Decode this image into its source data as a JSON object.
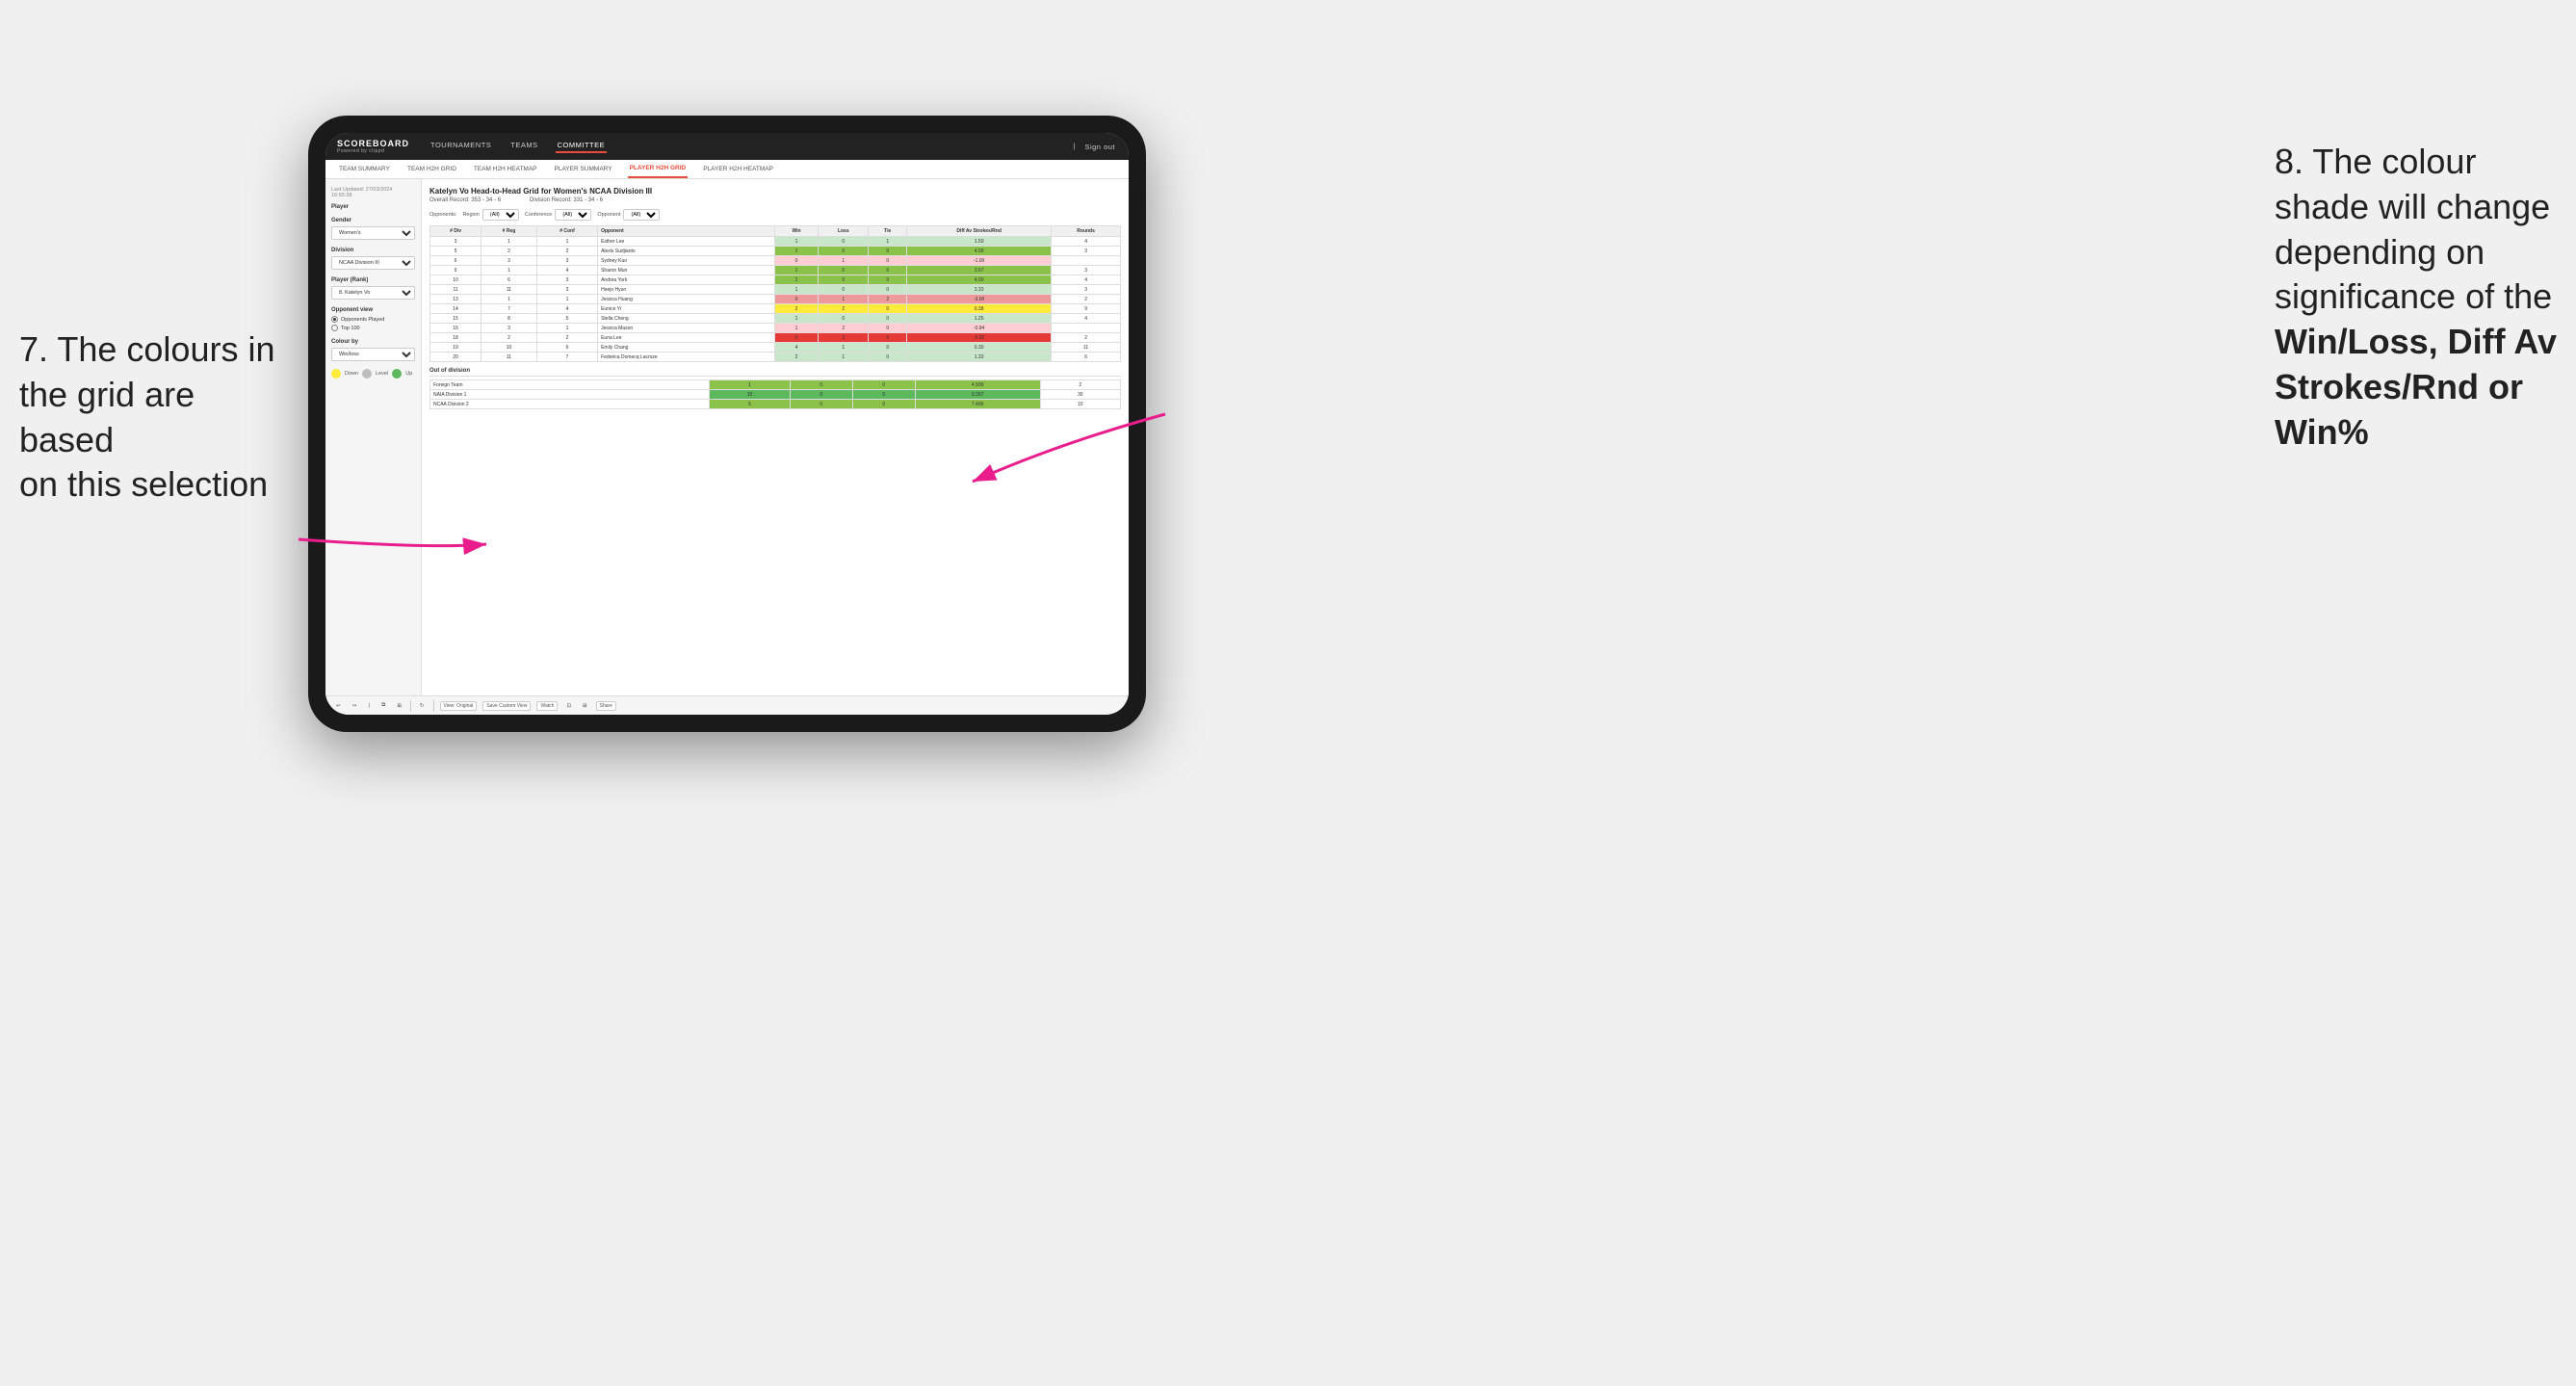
{
  "annotations": {
    "left_text_line1": "7. The colours in",
    "left_text_line2": "the grid are based",
    "left_text_line3": "on this selection",
    "right_text_line1": "8. The colour",
    "right_text_line2": "shade will change",
    "right_text_line3": "depending on",
    "right_text_line4": "significance of the",
    "right_text_bold1": "Win/Loss,",
    "right_text_bold2": "Diff Av",
    "right_text_bold3": "Strokes/Rnd",
    "right_text_bold4": "or",
    "right_text_bold5": "Win%"
  },
  "nav": {
    "logo": "SCOREBOARD",
    "logo_sub": "Powered by clippd",
    "items": [
      "TOURNAMENTS",
      "TEAMS",
      "COMMITTEE"
    ],
    "sign_in": "Sign out"
  },
  "sub_nav": {
    "items": [
      "TEAM SUMMARY",
      "TEAM H2H GRID",
      "TEAM H2H HEATMAP",
      "PLAYER SUMMARY",
      "PLAYER H2H GRID",
      "PLAYER H2H HEATMAP"
    ]
  },
  "sidebar": {
    "meta": "Last Updated: 27/03/2024\n16:55:38",
    "player_label": "Player",
    "gender_label": "Gender",
    "gender_value": "Women's",
    "division_label": "Division",
    "division_value": "NCAA Division III",
    "player_rank_label": "Player (Rank)",
    "player_rank_value": "8. Katelyn Vo",
    "opponent_view_label": "Opponent view",
    "radio1": "Opponents Played",
    "radio2": "Top 100",
    "colour_by_label": "Colour by",
    "colour_by_value": "Win/loss",
    "legend": {
      "down_label": "Down",
      "level_label": "Level",
      "up_label": "Up"
    }
  },
  "grid": {
    "title": "Katelyn Vo Head-to-Head Grid for Women's NCAA Division III",
    "overall_record": "Overall Record: 353 - 34 - 6",
    "division_record": "Division Record: 331 - 34 - 6",
    "opponents_label": "Opponents:",
    "region_label": "Region",
    "conference_label": "Conference",
    "opponent_label": "Opponent",
    "filter_all": "(All)",
    "columns": {
      "div": "# Div",
      "reg": "# Reg",
      "conf": "# Conf",
      "opponent": "Opponent",
      "win": "Win",
      "loss": "Loss",
      "tie": "Tie",
      "diff_av": "Diff Av Strokes/Rnd",
      "rounds": "Rounds"
    },
    "rows": [
      {
        "div": 3,
        "reg": 1,
        "conf": 1,
        "opponent": "Esther Lee",
        "win": 1,
        "loss": 0,
        "tie": 1,
        "diff_av": 1.5,
        "rounds": 4,
        "win_color": "green_light",
        "diff_color": "green_light"
      },
      {
        "div": 5,
        "reg": 2,
        "conf": 2,
        "opponent": "Alexis Sudjianto",
        "win": 1,
        "loss": 0,
        "tie": 0,
        "diff_av": 4.0,
        "rounds": 3,
        "win_color": "green_med",
        "diff_color": "green_med"
      },
      {
        "div": 6,
        "reg": 3,
        "conf": 3,
        "opponent": "Sydney Kuo",
        "win": 0,
        "loss": 1,
        "tie": 0,
        "diff_av": -1.0,
        "rounds": "",
        "win_color": "red_light",
        "diff_color": "red_light"
      },
      {
        "div": 9,
        "reg": 1,
        "conf": 4,
        "opponent": "Sharon Mun",
        "win": 1,
        "loss": 0,
        "tie": 0,
        "diff_av": 3.67,
        "rounds": 3,
        "win_color": "green_med",
        "diff_color": "green_med"
      },
      {
        "div": 10,
        "reg": 6,
        "conf": 3,
        "opponent": "Andrea York",
        "win": 2,
        "loss": 0,
        "tie": 0,
        "diff_av": 4.0,
        "rounds": 4,
        "win_color": "green_med",
        "diff_color": "green_med"
      },
      {
        "div": 11,
        "reg": 11,
        "conf": 3,
        "opponent": "Heejo Hyun",
        "win": 1,
        "loss": 0,
        "tie": 0,
        "diff_av": 3.33,
        "rounds": 3,
        "win_color": "green_light",
        "diff_color": "green_light"
      },
      {
        "div": 13,
        "reg": 1,
        "conf": 1,
        "opponent": "Jessica Huang",
        "win": 0,
        "loss": 1,
        "tie": 2,
        "diff_av": -3.0,
        "rounds": 2,
        "win_color": "red_med",
        "diff_color": "red_med"
      },
      {
        "div": 14,
        "reg": 7,
        "conf": 4,
        "opponent": "Eunice Yi",
        "win": 2,
        "loss": 2,
        "tie": 0,
        "diff_av": 0.38,
        "rounds": 9,
        "win_color": "yellow",
        "diff_color": "yellow"
      },
      {
        "div": 15,
        "reg": 8,
        "conf": 5,
        "opponent": "Stella Cheng",
        "win": 1,
        "loss": 0,
        "tie": 0,
        "diff_av": 1.25,
        "rounds": 4,
        "win_color": "green_light",
        "diff_color": "green_light"
      },
      {
        "div": 16,
        "reg": 3,
        "conf": 1,
        "opponent": "Jessica Mason",
        "win": 1,
        "loss": 2,
        "tie": 0,
        "diff_av": -0.94,
        "rounds": "",
        "win_color": "red_light",
        "diff_color": "red_light"
      },
      {
        "div": 18,
        "reg": 2,
        "conf": 2,
        "opponent": "Euna Lee",
        "win": 0,
        "loss": 2,
        "tie": 0,
        "diff_av": -5.0,
        "rounds": 2,
        "win_color": "red_dark",
        "diff_color": "red_dark"
      },
      {
        "div": 19,
        "reg": 10,
        "conf": 6,
        "opponent": "Emily Chang",
        "win": 4,
        "loss": 1,
        "tie": 0,
        "diff_av": 0.3,
        "rounds": 11,
        "win_color": "green_light",
        "diff_color": "green_light"
      },
      {
        "div": 20,
        "reg": 11,
        "conf": 7,
        "opponent": "Federica Domecq Lacroze",
        "win": 2,
        "loss": 1,
        "tie": 0,
        "diff_av": 1.33,
        "rounds": 6,
        "win_color": "green_light",
        "diff_color": "green_light"
      }
    ],
    "out_of_division": {
      "label": "Out of division",
      "rows": [
        {
          "name": "Foreign Team",
          "win": 1,
          "loss": 0,
          "tie": 0,
          "diff_av": 4.5,
          "rounds": 2,
          "win_color": "green_med",
          "diff_color": "green_med"
        },
        {
          "name": "NAIA Division 1",
          "win": 15,
          "loss": 0,
          "tie": 0,
          "diff_av": 9.267,
          "rounds": 30,
          "win_color": "green_dark",
          "diff_color": "green_dark"
        },
        {
          "name": "NCAA Division 2",
          "win": 5,
          "loss": 0,
          "tie": 0,
          "diff_av": 7.4,
          "rounds": 10,
          "win_color": "green_med",
          "diff_color": "green_med"
        }
      ]
    }
  },
  "toolbar": {
    "view_original": "View: Original",
    "save_custom": "Save Custom View",
    "watch": "Watch",
    "share": "Share"
  }
}
